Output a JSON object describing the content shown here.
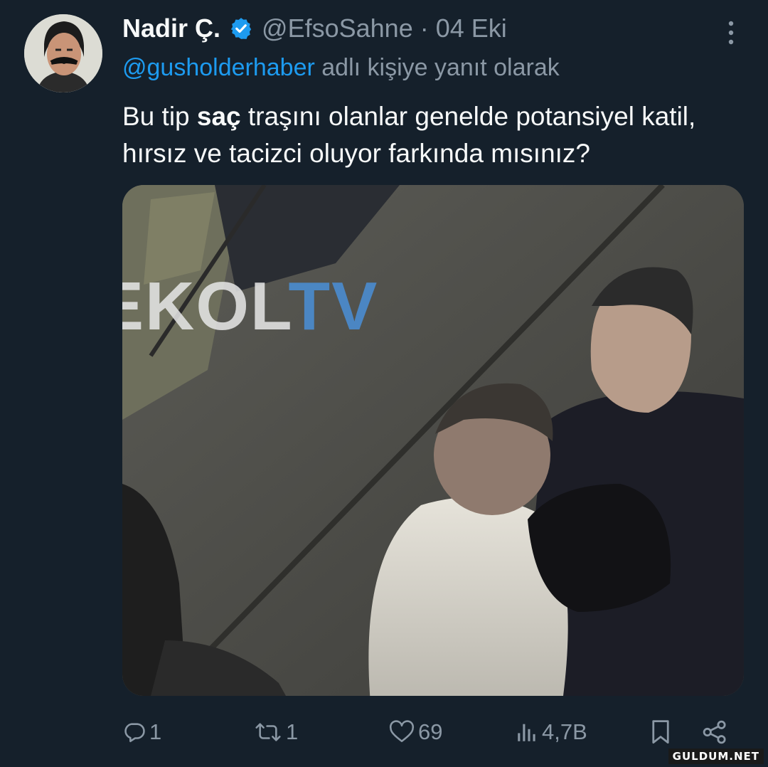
{
  "author": {
    "display_name": "Nadir Ç.",
    "handle": "@EfsoSahne",
    "separator": "·",
    "date": "04 Eki",
    "verified_icon": "verified-badge-icon",
    "avatar": "avatar-image"
  },
  "reply_context": {
    "handle": "@gusholderhaber",
    "suffix": " adlı kişiye yanıt olarak"
  },
  "body": {
    "part1": "Bu tip ",
    "bold": "saç",
    "part2": " traşını olanlar genelde potansiyel katil, hırsız ve tacizci oluyor farkında mısınız?"
  },
  "media": {
    "watermark_part1": "EKOL",
    "watermark_part2": "TV"
  },
  "actions": {
    "reply_count": "1",
    "retweet_count": "1",
    "like_count": "69",
    "view_count": "4,7B"
  },
  "site_mark": "GULDUM.NET",
  "colors": {
    "background": "#15202b",
    "accent": "#1d9bf0",
    "secondary_text": "#8b98a5",
    "primary_text": "#f7f9f9"
  }
}
